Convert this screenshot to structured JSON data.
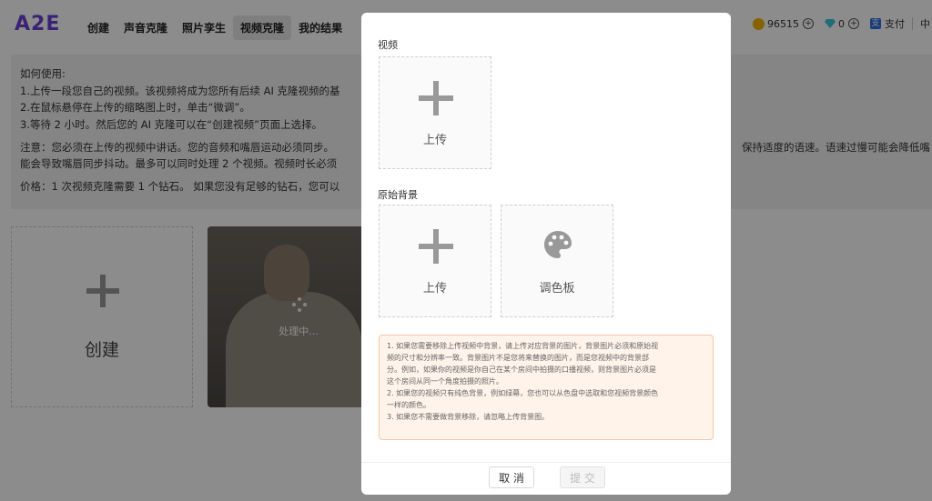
{
  "app": {
    "logo": "A2E"
  },
  "nav": {
    "items": [
      {
        "label": "创建",
        "active": false
      },
      {
        "label": "声音克隆",
        "active": false
      },
      {
        "label": "照片孪生",
        "active": false
      },
      {
        "label": "视频克隆",
        "active": true
      },
      {
        "label": "我的结果",
        "active": false
      }
    ]
  },
  "account": {
    "coins": "96515",
    "diamonds": "0",
    "pay_label": "支付",
    "lang": "中"
  },
  "info": {
    "heading": "如何使用:",
    "steps": [
      "1.上传一段您自己的视频。该视频将成为您所有后续 AI 克隆视频的基",
      "2.在鼠标悬停在上传的缩略图上时，单击“微调”。",
      "3.等待 2 小时。然后您的 AI 克隆可以在“创建视频”页面上选择。"
    ],
    "note_line1": "注意：您必须在上传的视频中讲话。您的音频和嘴唇运动必须同步。",
    "note_line1_right": "保持适度的语速。语速过慢可能会降低嘴",
    "note_line2": "能会导致嘴唇同步抖动。最多可以同时处理 2 个视频。视频时长必须",
    "price": "价格：1 次视频克隆需要 1 个钻石。 如果您没有足够的钻石，您可以"
  },
  "cards": {
    "create_label": "创建",
    "processing_label": "处理中..."
  },
  "modal": {
    "video_section": "视频",
    "upload_label": "上传",
    "bg_section": "原始背景",
    "bg_upload_label": "上传",
    "palette_label": "调色板",
    "notice": [
      "1. 如果您需要移除上传视频中背景，请上传对应背景的图片，背景图片必须和原始视",
      "频的尺寸和分辨率一致。背景图片不是您将来替换的图片，而是您视频中的背景部",
      "分。例如，如果你的视频是你自己在某个房间中拍摄的口播视频，则背景图片必须是",
      "这个房间从同一个角度拍摄的照片。",
      "2. 如果您的视频只有纯色背景，例如绿幕，您也可以从色盘中选取和您视频背景颜色",
      "一样的颜色。",
      "3. 如果您不需要做背景移除，请忽略上传背景图。"
    ],
    "cancel_label": "取 消",
    "submit_label": "提 交"
  },
  "colors": {
    "logo": "#6b3fd4",
    "notice_bg": "#fff3ea",
    "notice_border": "#f3c7a7"
  }
}
